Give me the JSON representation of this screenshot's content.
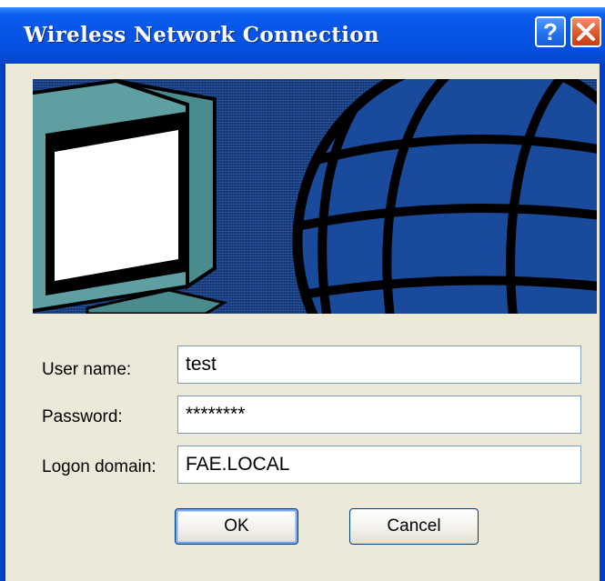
{
  "window": {
    "title": "Wireless Network Connection",
    "help_glyph": "?",
    "close_glyph": "✕",
    "help_icon": "question-mark-icon",
    "close_icon": "close-x-icon"
  },
  "banner": {
    "illustration": "computer-monitor-and-globe",
    "colors": {
      "background": "#173f86",
      "globe": "#1a4a9b",
      "monitor": "#5e9ea0"
    }
  },
  "form": {
    "username": {
      "label": "User name:",
      "value": "test"
    },
    "password": {
      "label": "Password:",
      "value": "********"
    },
    "domain": {
      "label": "Logon domain:",
      "value": "FAE.LOCAL"
    }
  },
  "buttons": {
    "ok": "OK",
    "cancel": "Cancel"
  },
  "colors": {
    "titlebar": "#0654e6",
    "dialog_face": "#ece9d8",
    "close_button": "#e0552a"
  }
}
